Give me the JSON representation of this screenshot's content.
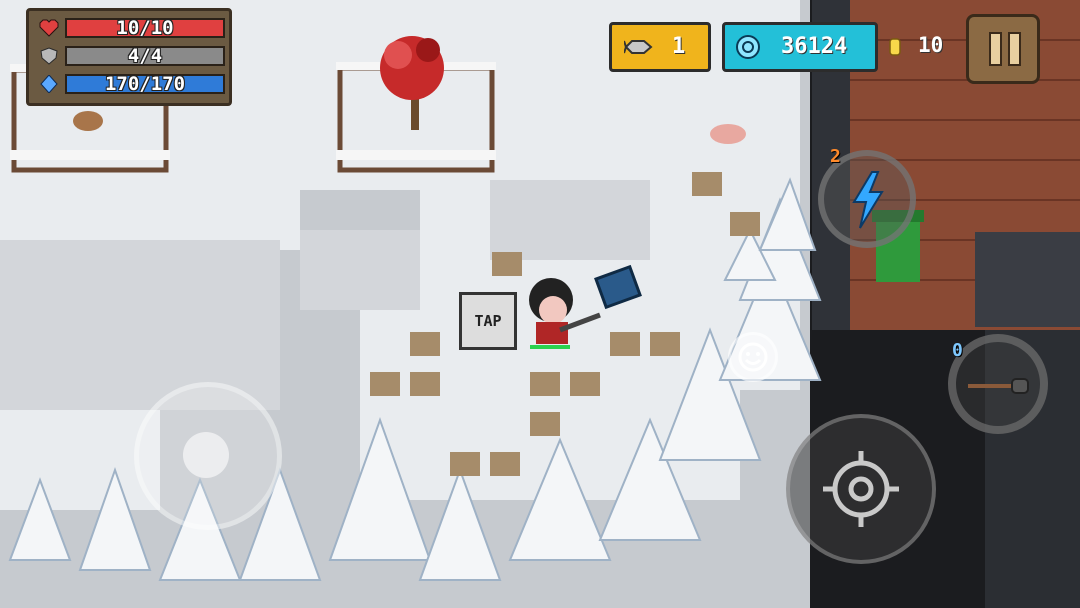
{
  "hud": {
    "health": {
      "label": "10/10",
      "current": 10,
      "max": 10,
      "color": "#e04040"
    },
    "armor": {
      "label": "4/4",
      "current": 4,
      "max": 4,
      "color": "#8a8a8a"
    },
    "energy": {
      "label": "170/170",
      "current": 170,
      "max": 170,
      "color": "#2f7bd8"
    }
  },
  "currency": {
    "fish": "1",
    "gems": "36124",
    "gold": "10"
  },
  "controls": {
    "tap_label": "TAP",
    "skill_badge": "2",
    "weapon_badge": "0"
  },
  "colors": {
    "fish_pill": "#f0b41c",
    "gem_pill": "#23c0d8",
    "skill_blue": "#33a8ff"
  }
}
